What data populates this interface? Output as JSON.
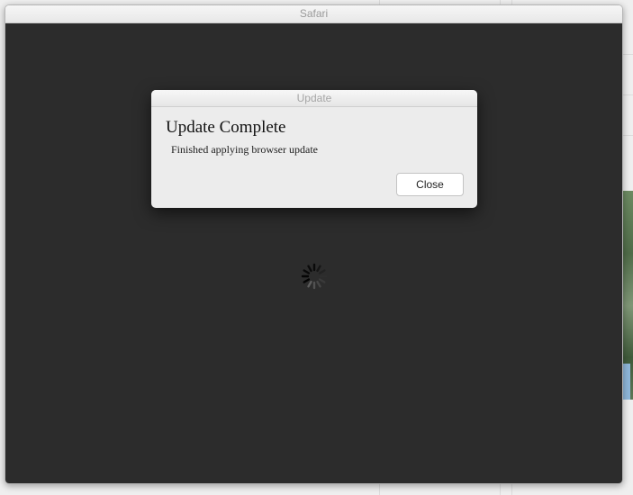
{
  "window": {
    "title": "Safari"
  },
  "dialog": {
    "title": "Update",
    "heading": "Update Complete",
    "message": "Finished applying browser update",
    "close_label": "Close"
  },
  "icons": {
    "loading": "loading-spinner-icon"
  },
  "colors": {
    "content_background": "#2c2c2c",
    "dialog_background": "#ececec",
    "button_background": "#ffffff"
  }
}
